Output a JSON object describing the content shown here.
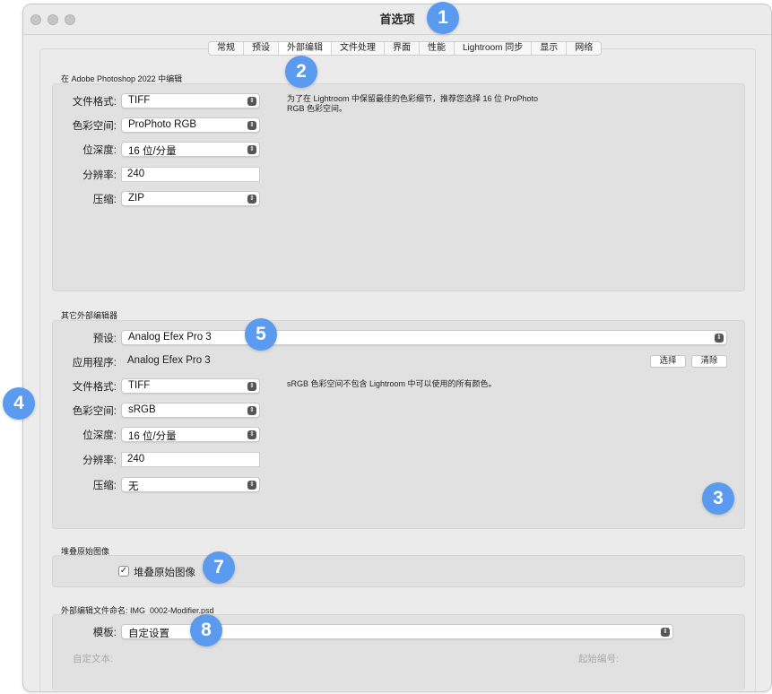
{
  "window": {
    "title": "首选项"
  },
  "tabs": [
    "常规",
    "预设",
    "外部编辑",
    "文件处理",
    "界面",
    "性能",
    "Lightroom 同步",
    "显示",
    "网络"
  ],
  "photoshop": {
    "section_label": "在 Adobe Photoshop 2022 中编辑",
    "file_format_label": "文件格式:",
    "file_format": "TIFF",
    "color_space_label": "色彩空间:",
    "color_space": "ProPhoto RGB",
    "bit_depth_label": "位深度:",
    "bit_depth": "16 位/分量",
    "resolution_label": "分辨率:",
    "resolution": "240",
    "compression_label": "压缩:",
    "compression": "ZIP",
    "note_line1": "为了在 Lightroom 中保留最佳的色彩细节，推荐您选择 16 位 ProPhoto",
    "note_line2": "RGB 色彩空间。"
  },
  "other_editor": {
    "section_label": "其它外部编辑器",
    "preset_label": "预设:",
    "preset": "Analog Efex Pro 3",
    "app_label": "应用程序:",
    "app": "Analog Efex Pro 3",
    "choose_button": "选择",
    "clear_button": "清除",
    "file_format_label": "文件格式:",
    "file_format": "TIFF",
    "color_space_label": "色彩空间:",
    "color_space": "sRGB",
    "bit_depth_label": "位深度:",
    "bit_depth": "16 位/分量",
    "resolution_label": "分辨率:",
    "resolution": "240",
    "compression_label": "压缩:",
    "compression": "无",
    "note": "sRGB 色彩空间不包含 Lightroom 中可以使用的所有颜色。"
  },
  "stack": {
    "section_label": "堆叠原始图像",
    "checkbox_label": "堆叠原始图像",
    "checked": true
  },
  "naming": {
    "section_label": "外部编辑文件命名: IMG_0002-Modifier.psd",
    "template_label": "模板:",
    "template": "自定设置",
    "custom_text_label": "自定文本:",
    "start_number_label": "起始编号:"
  },
  "badges": [
    "1",
    "2",
    "3",
    "4",
    "5",
    "7",
    "8"
  ],
  "colors": {
    "badge": "#5b9bef"
  }
}
